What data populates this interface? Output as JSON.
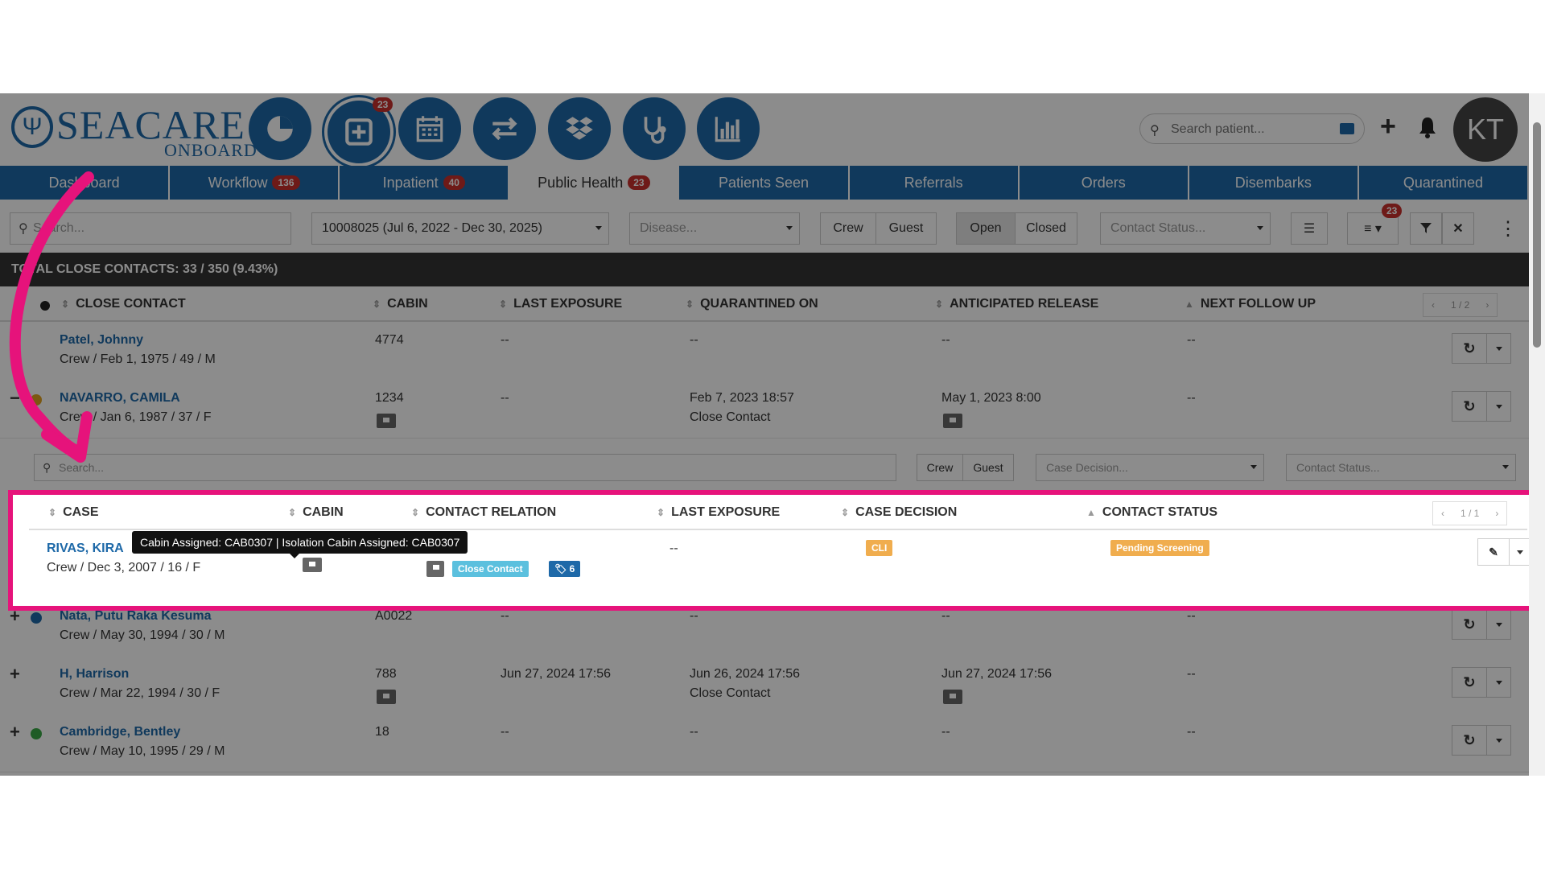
{
  "header": {
    "logo_sea": "SEACARE",
    "logo_onboard": "ONBOARD",
    "add_badge": "23",
    "search_placeholder": "Search patient...",
    "avatar_initials": "KT"
  },
  "nav": {
    "tabs": [
      {
        "label": "Dashboard",
        "count": ""
      },
      {
        "label": "Workflow",
        "count": "136"
      },
      {
        "label": "Inpatient",
        "count": "40"
      },
      {
        "label": "Public Health",
        "count": "23"
      },
      {
        "label": "Patients Seen",
        "count": ""
      },
      {
        "label": "Referrals",
        "count": ""
      },
      {
        "label": "Orders",
        "count": ""
      },
      {
        "label": "Disembarks",
        "count": ""
      },
      {
        "label": "Quarantined",
        "count": ""
      }
    ]
  },
  "filters": {
    "search_placeholder": "Search...",
    "voyage": "10008025 (Jul 6, 2022 - Dec 30, 2025)",
    "disease_placeholder": "Disease...",
    "crew": "Crew",
    "guest": "Guest",
    "open": "Open",
    "closed": "Closed",
    "contact_status_placeholder": "Contact Status...",
    "list_badge": "23"
  },
  "summary": "TOTAL CLOSE CONTACTS: 33 / 350 (9.43%)",
  "table": {
    "headers": {
      "close_contact": "CLOSE CONTACT",
      "cabin": "CABIN",
      "last_exposure": "LAST EXPOSURE",
      "quarantined_on": "QUARANTINED ON",
      "anticipated_release": "ANTICIPATED RELEASE",
      "next_follow_up": "NEXT FOLLOW UP"
    },
    "pager": "1 / 2",
    "rows": [
      {
        "toggle": "+",
        "dot_color": "",
        "name": "Patel, Johnny",
        "sub": "Crew / Feb 1, 1975 / 49 / M",
        "cabin": "4774",
        "last_exposure": "--",
        "quarantined_on": "--",
        "quarantined_type": "",
        "release": "--",
        "follow_up": "--"
      },
      {
        "toggle": "−",
        "dot_color": "#e0a020",
        "name": "NAVARRO, CAMILA",
        "sub": "Crew / Jan 6, 1987 / 37 / F",
        "cabin": "1234",
        "last_exposure": "--",
        "quarantined_on": "Feb 7, 2023 18:57",
        "quarantined_type": "Close Contact",
        "release": "May 1, 2023 8:00",
        "follow_up": "--"
      },
      {
        "toggle": "+",
        "dot_color": "#1e69a8",
        "name": "Nata, Putu Raka Kesuma",
        "sub": "Crew / May 30, 1994 / 30 / M",
        "cabin": "A0022",
        "last_exposure": "--",
        "quarantined_on": "--",
        "quarantined_type": "",
        "release": "--",
        "follow_up": "--"
      },
      {
        "toggle": "+",
        "dot_color": "",
        "name": "H, Harrison",
        "sub": "Crew / Mar 22, 1994 / 30 / F",
        "cabin": "788",
        "last_exposure": "Jun 27, 2024 17:56",
        "quarantined_on": "Jun 26, 2024 17:56",
        "quarantined_type": "Close Contact",
        "release": "Jun 27, 2024 17:56",
        "follow_up": "--"
      },
      {
        "toggle": "+",
        "dot_color": "#3aa845",
        "name": "Cambridge, Bentley",
        "sub": "Crew / May 10, 1995 / 29 / M",
        "cabin": "18",
        "last_exposure": "--",
        "quarantined_on": "--",
        "quarantined_type": "",
        "release": "--",
        "follow_up": "--"
      }
    ]
  },
  "subtable": {
    "search_placeholder": "Search...",
    "crew": "Crew",
    "guest": "Guest",
    "case_decision_placeholder": "Case Decision...",
    "contact_status_placeholder": "Contact Status...",
    "headers": {
      "case": "CASE",
      "cabin": "CABIN",
      "contact_relation": "CONTACT RELATION",
      "last_exposure": "LAST EXPOSURE",
      "case_decision": "CASE DECISION",
      "contact_status": "CONTACT STATUS"
    },
    "pager": "1 / 1",
    "row": {
      "name": "RIVAS, KIRA",
      "sub": "Crew / Dec 3, 2007 / 16 / F",
      "relation_label": "Close Contact",
      "tag_count": "6",
      "last_exposure": "--",
      "case_decision": "CLI",
      "contact_status": "Pending Screening"
    },
    "tooltip": "Cabin Assigned: CAB0307 | Isolation Cabin Assigned: CAB0307"
  },
  "colors": {
    "brand": "#1e69a8",
    "highlight": "#e6137b",
    "badge": "#c8302c"
  }
}
